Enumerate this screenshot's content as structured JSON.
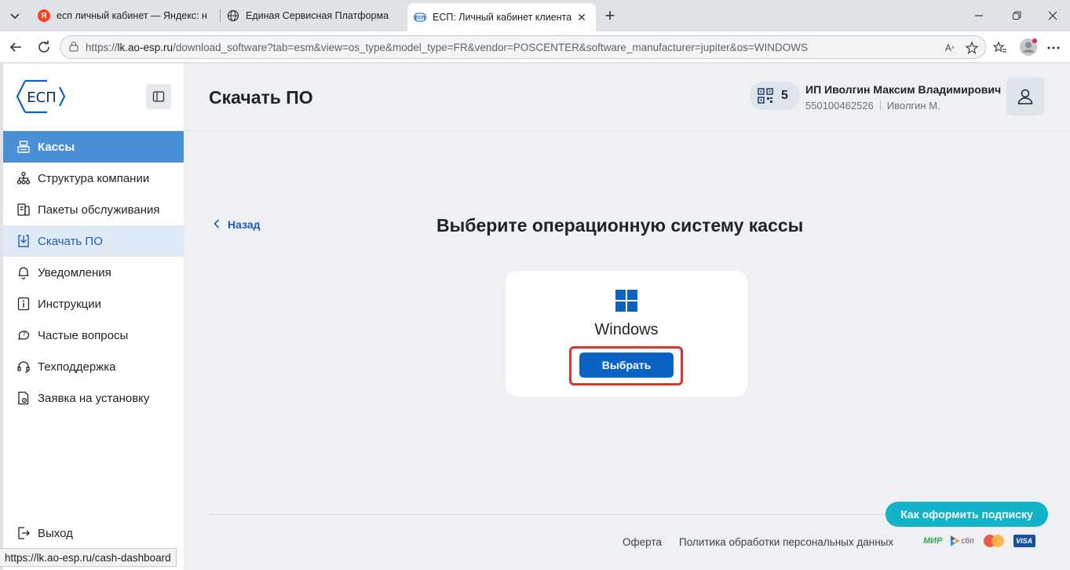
{
  "browser": {
    "tabs": [
      {
        "title": "есп личный кабинет — Яндекс: н",
        "favicon": "yandex-icon"
      },
      {
        "title": "Единая Сервисная Платформа",
        "favicon": "globe-icon"
      },
      {
        "title": "ЕСП: Личный кабинет клиента",
        "favicon": "esp-icon",
        "active": true
      }
    ],
    "url_prefix": "https://",
    "url_host": "lk.ao-esp.ru",
    "url_path": "/download_software?tab=esm&view=os_type&model_type=FR&vendor=POSCENTER&software_manufacturer=jupiter&os=WINDOWS",
    "status_url": "https://lk.ao-esp.ru/cash-dashboard"
  },
  "logo_text": "ЕСП",
  "sidebar": {
    "items": [
      {
        "label": "Кассы",
        "icon": "cash-register-icon"
      },
      {
        "label": "Структура компании",
        "icon": "org-structure-icon"
      },
      {
        "label": "Пакеты обслуживания",
        "icon": "service-package-icon"
      },
      {
        "label": "Скачать ПО",
        "icon": "download-icon"
      },
      {
        "label": "Уведомления",
        "icon": "bell-icon"
      },
      {
        "label": "Инструкции",
        "icon": "info-icon"
      },
      {
        "label": "Частые вопросы",
        "icon": "faq-icon"
      },
      {
        "label": "Техподдержка",
        "icon": "headset-icon"
      },
      {
        "label": "Заявка на установку",
        "icon": "install-request-icon"
      }
    ],
    "logout_label": "Выход"
  },
  "header": {
    "title": "Скачать ПО",
    "qr_count": "5",
    "user_name": "ИП Иволгин Максим Владимирович",
    "inn": "550100462526",
    "short_name": "Иволгин М."
  },
  "main": {
    "back_label": "Назад",
    "section_title": "Выберите операционную систему кассы",
    "os_name": "Windows",
    "select_label": "Выбрать"
  },
  "footer": {
    "subscribe_label": "Как оформить подписку",
    "offer_label": "Оферта",
    "privacy_label": "Политика обработки персональных данных",
    "pay_mir": "МИР",
    "pay_sbp": "сбп",
    "pay_visa": "VISA"
  },
  "colors": {
    "accent": "#0b63c4",
    "sidebar_selected": "#4a90d9",
    "highlight_border": "#d9352b",
    "subscribe": "#12b3c9"
  }
}
